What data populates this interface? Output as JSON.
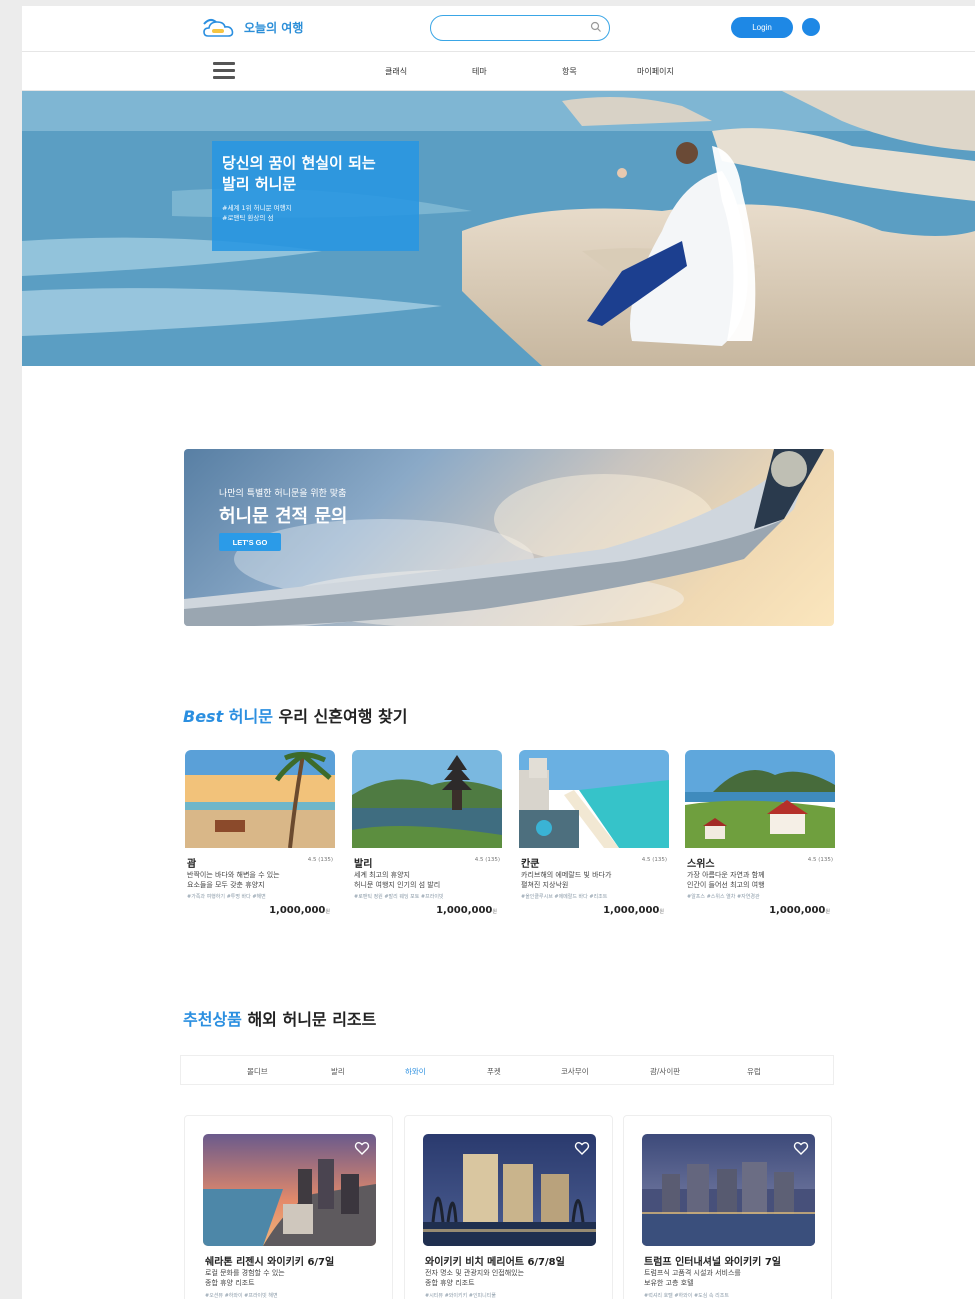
{
  "header": {
    "logo_text": "오늘의 여행",
    "login_label": "Login"
  },
  "nav": {
    "items": [
      "클래식",
      "테마",
      "항목",
      "마이페이지"
    ]
  },
  "hero": {
    "title_line1": "당신의 꿈이 현실이 되는",
    "title_line2": "발리 허니문",
    "sub_line1": "#세계 1위 허니문 여행지",
    "sub_line2": "#로맨틱 환상의 섬"
  },
  "promo": {
    "subtitle": "나만의 특별한 허니문을 위한 맞춤",
    "title": "허니문 견적 문의",
    "button_label": "LET'S GO"
  },
  "best": {
    "title_italic": "Best",
    "title_accent": " 허니문",
    "title_rest": " 우리 신혼여행 찾기",
    "cards": [
      {
        "name": "괌",
        "rating": "4.5 (135)",
        "desc1": "반짝이는 바다와 해변을 수 있는",
        "desc2": "요소들을 모두 갖춘 휴양지",
        "tags": "#가족과 여행하기   #투명 바다   #해변",
        "price": "1,000,000",
        "currency": "원"
      },
      {
        "name": "발리",
        "rating": "4.5 (135)",
        "desc1": "세계 최고의 휴양지",
        "desc2": "허니문 여행지 인기의 섬 발리",
        "tags": "#로맨틱 정원   #발리 웨딩 포토   #프라이빗",
        "price": "1,000,000",
        "currency": "원"
      },
      {
        "name": "칸쿤",
        "rating": "4.5 (135)",
        "desc1": "카리브해의 에메랄드 빛 바다가",
        "desc2": "펼쳐진 지상낙원",
        "tags": "#올인클루시브   #에메랄드 바다   #리조트",
        "price": "1,000,000",
        "currency": "원"
      },
      {
        "name": "스위스",
        "rating": "4.5 (135)",
        "desc1": "가장 아름다운 자연과 함께",
        "desc2": "인간이 들어선 최고의 여행",
        "tags": "#알프스   #스위스 열차   #자연경관",
        "price": "1,000,000",
        "currency": "원"
      }
    ]
  },
  "recommend": {
    "title_accent": "추천상품",
    "title_rest": " 해외 허니문 리조트",
    "tabs": [
      "몰디브",
      "발리",
      "하와이",
      "푸켓",
      "코사무이",
      "괌/사이판",
      "유럽"
    ],
    "active_tab": 2,
    "cards": [
      {
        "name": "쉐라톤 리젠시 와이키키 6/7일",
        "desc1": "로컬 문화를 경험할 수 있는",
        "desc2": "종합 휴양 리조트",
        "tags": "#오션뷰   #하와이   #프라이빗 해변"
      },
      {
        "name": "와이키키 비치 메리어트 6/7/8일",
        "desc1": "전자 명소 및 관광지와 인접해있는",
        "desc2": "종합 휴양 리조트",
        "tags": "#시티뷰   #와이키키   #인피니티풀"
      },
      {
        "name": "트럼프 인터내셔널 와이키키 7일",
        "desc1": "트럼프식 고품격 시설과 서비스를",
        "desc2": "보유한 고층 호텔",
        "tags": "#럭셔리 호텔   #하와이   #도심 속 리조트"
      }
    ]
  }
}
